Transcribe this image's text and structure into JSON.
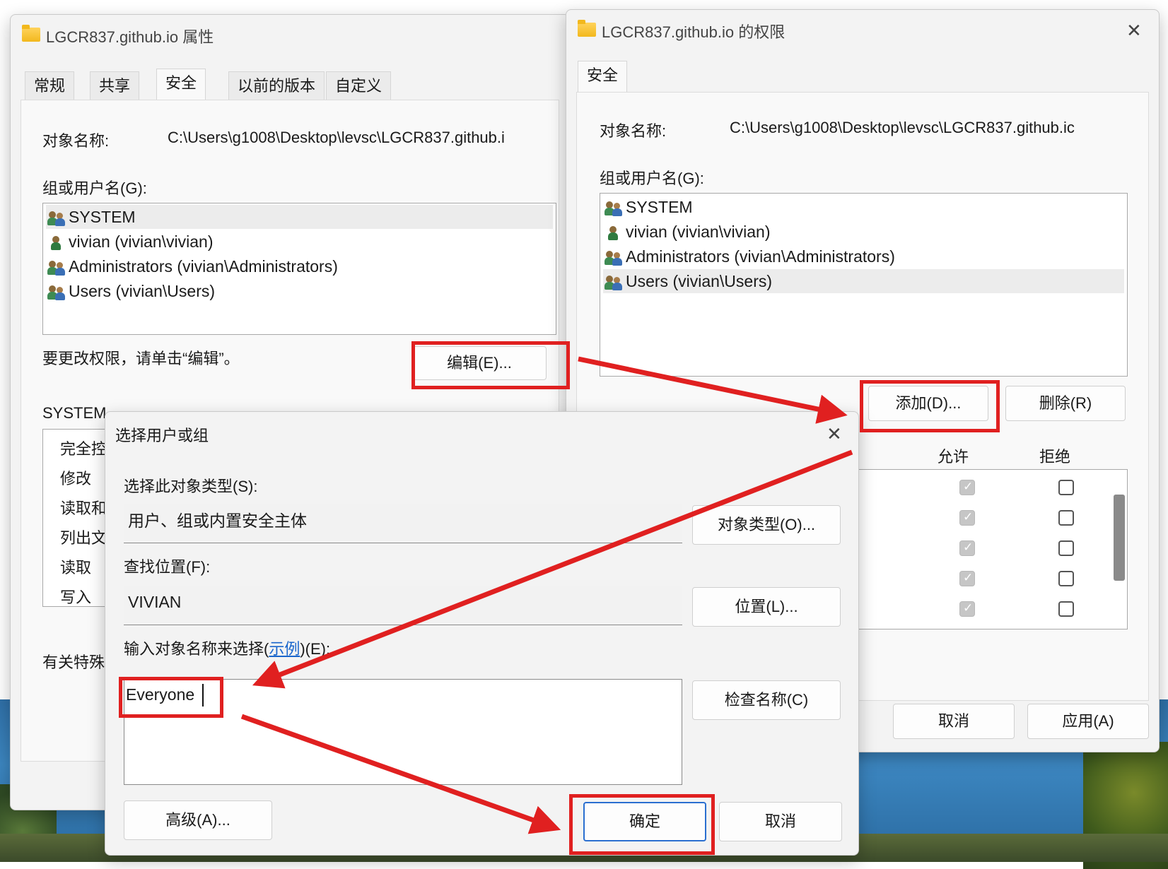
{
  "props_window": {
    "title": "LGCR837.github.io 属性",
    "tabs": [
      "常规",
      "共享",
      "安全",
      "以前的版本",
      "自定义"
    ],
    "object_name_label": "对象名称:",
    "object_name_value": "C:\\Users\\g1008\\Desktop\\levsc\\LGCR837.github.i",
    "group_label": "组或用户名(G):",
    "users": [
      "SYSTEM",
      "vivian (vivian\\vivian)",
      "Administrators (vivian\\Administrators)",
      "Users (vivian\\Users)"
    ],
    "change_hint": "要更改权限，请单击“编辑”。",
    "edit_button": "编辑(E)...",
    "perm_label": "SYSTEM",
    "perm_items": [
      "完全控",
      "修改",
      "读取和",
      "列出文",
      "读取",
      "写入"
    ],
    "special_label": "有关特殊"
  },
  "perm_window": {
    "title": "LGCR837.github.io 的权限",
    "close_glyph": "✕",
    "tab": "安全",
    "object_name_label": "对象名称:",
    "object_name_value": "C:\\Users\\g1008\\Desktop\\levsc\\LGCR837.github.ic",
    "group_label": "组或用户名(G):",
    "users": [
      "SYSTEM",
      "vivian (vivian\\vivian)",
      "Administrators (vivian\\Administrators)",
      "Users (vivian\\Users)"
    ],
    "selected_user_index": 3,
    "add_button": "添加(D)...",
    "remove_button": "删除(R)",
    "allow_header": "允许",
    "deny_header": "拒绝",
    "allow_checked": [
      true,
      true,
      true,
      true,
      true
    ],
    "deny_checked": [
      false,
      false,
      false,
      false,
      false
    ],
    "cancel_button": "取消",
    "apply_button": "应用(A)"
  },
  "select_dialog": {
    "title": "选择用户或组",
    "close_glyph": "✕",
    "object_type_label": "选择此对象类型(S):",
    "object_type_value": "用户、组或内置安全主体",
    "object_type_button": "对象类型(O)...",
    "location_label": "查找位置(F):",
    "location_value": "VIVIAN",
    "location_button": "位置(L)...",
    "enter_label_prefix": "输入对象名称来选择(",
    "enter_label_link": "示例",
    "enter_label_suffix": ")(E):",
    "input_value": "Everyone",
    "check_names_button": "检查名称(C)",
    "advanced_button": "高级(A)...",
    "ok_button": "确定",
    "cancel_button": "取消"
  },
  "colors": {
    "highlight": "#e02020",
    "link": "#1a66cc",
    "primary_border": "#2a6fd0"
  }
}
